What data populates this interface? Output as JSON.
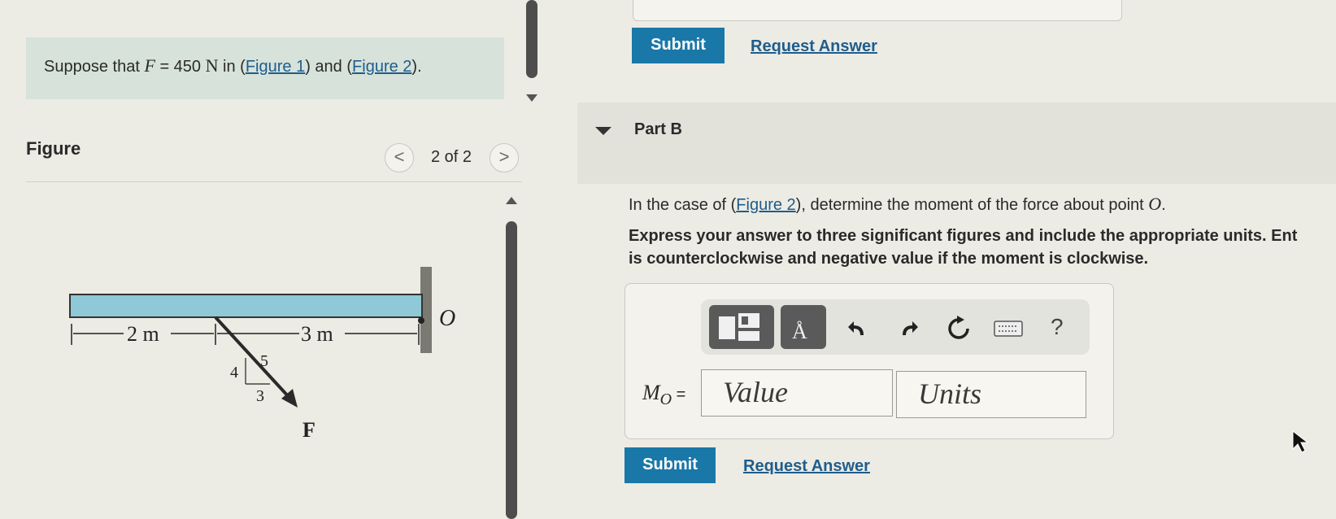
{
  "top_actions": {
    "submit_label": "Submit",
    "request_label": "Request Answer"
  },
  "intro": {
    "prefix": "Suppose that ",
    "var_F": "F",
    "equals": " = 450 ",
    "unit": "N",
    "middle": " in (",
    "link1": "Figure 1",
    "between": ") and (",
    "link2": "Figure 2",
    "suffix": ")."
  },
  "figure": {
    "heading": "Figure",
    "pager": "2 of 2",
    "prev_symbol": "<",
    "next_symbol": ">",
    "diagram": {
      "dim_left": "2 m",
      "dim_right": "3 m",
      "slope_4": "4",
      "slope_5": "5",
      "slope_3": "3",
      "force_label": "F",
      "point_label": "O"
    }
  },
  "part_b": {
    "label": "Part B",
    "question_prefix": "In the case of (",
    "question_link": "Figure 2",
    "question_suffix": "), determine the moment of the force about point ",
    "question_point": "O",
    "question_end": ".",
    "instruction_line1": "Express your answer to three significant figures and include the appropriate units. Ent",
    "instruction_line2": "is counterclockwise and negative value if the moment is clockwise.",
    "toolbar": {
      "units_symbol": "Å",
      "help": "?"
    },
    "mo_label_main": "M",
    "mo_label_sub": "O",
    "mo_label_eq": " =",
    "value_placeholder": "Value",
    "units_placeholder": "Units",
    "submit_label": "Submit",
    "request_label": "Request Answer"
  },
  "colors": {
    "accent": "#1978a8",
    "beam": "#8fc8d6",
    "intro_bg": "#d6e2da"
  }
}
